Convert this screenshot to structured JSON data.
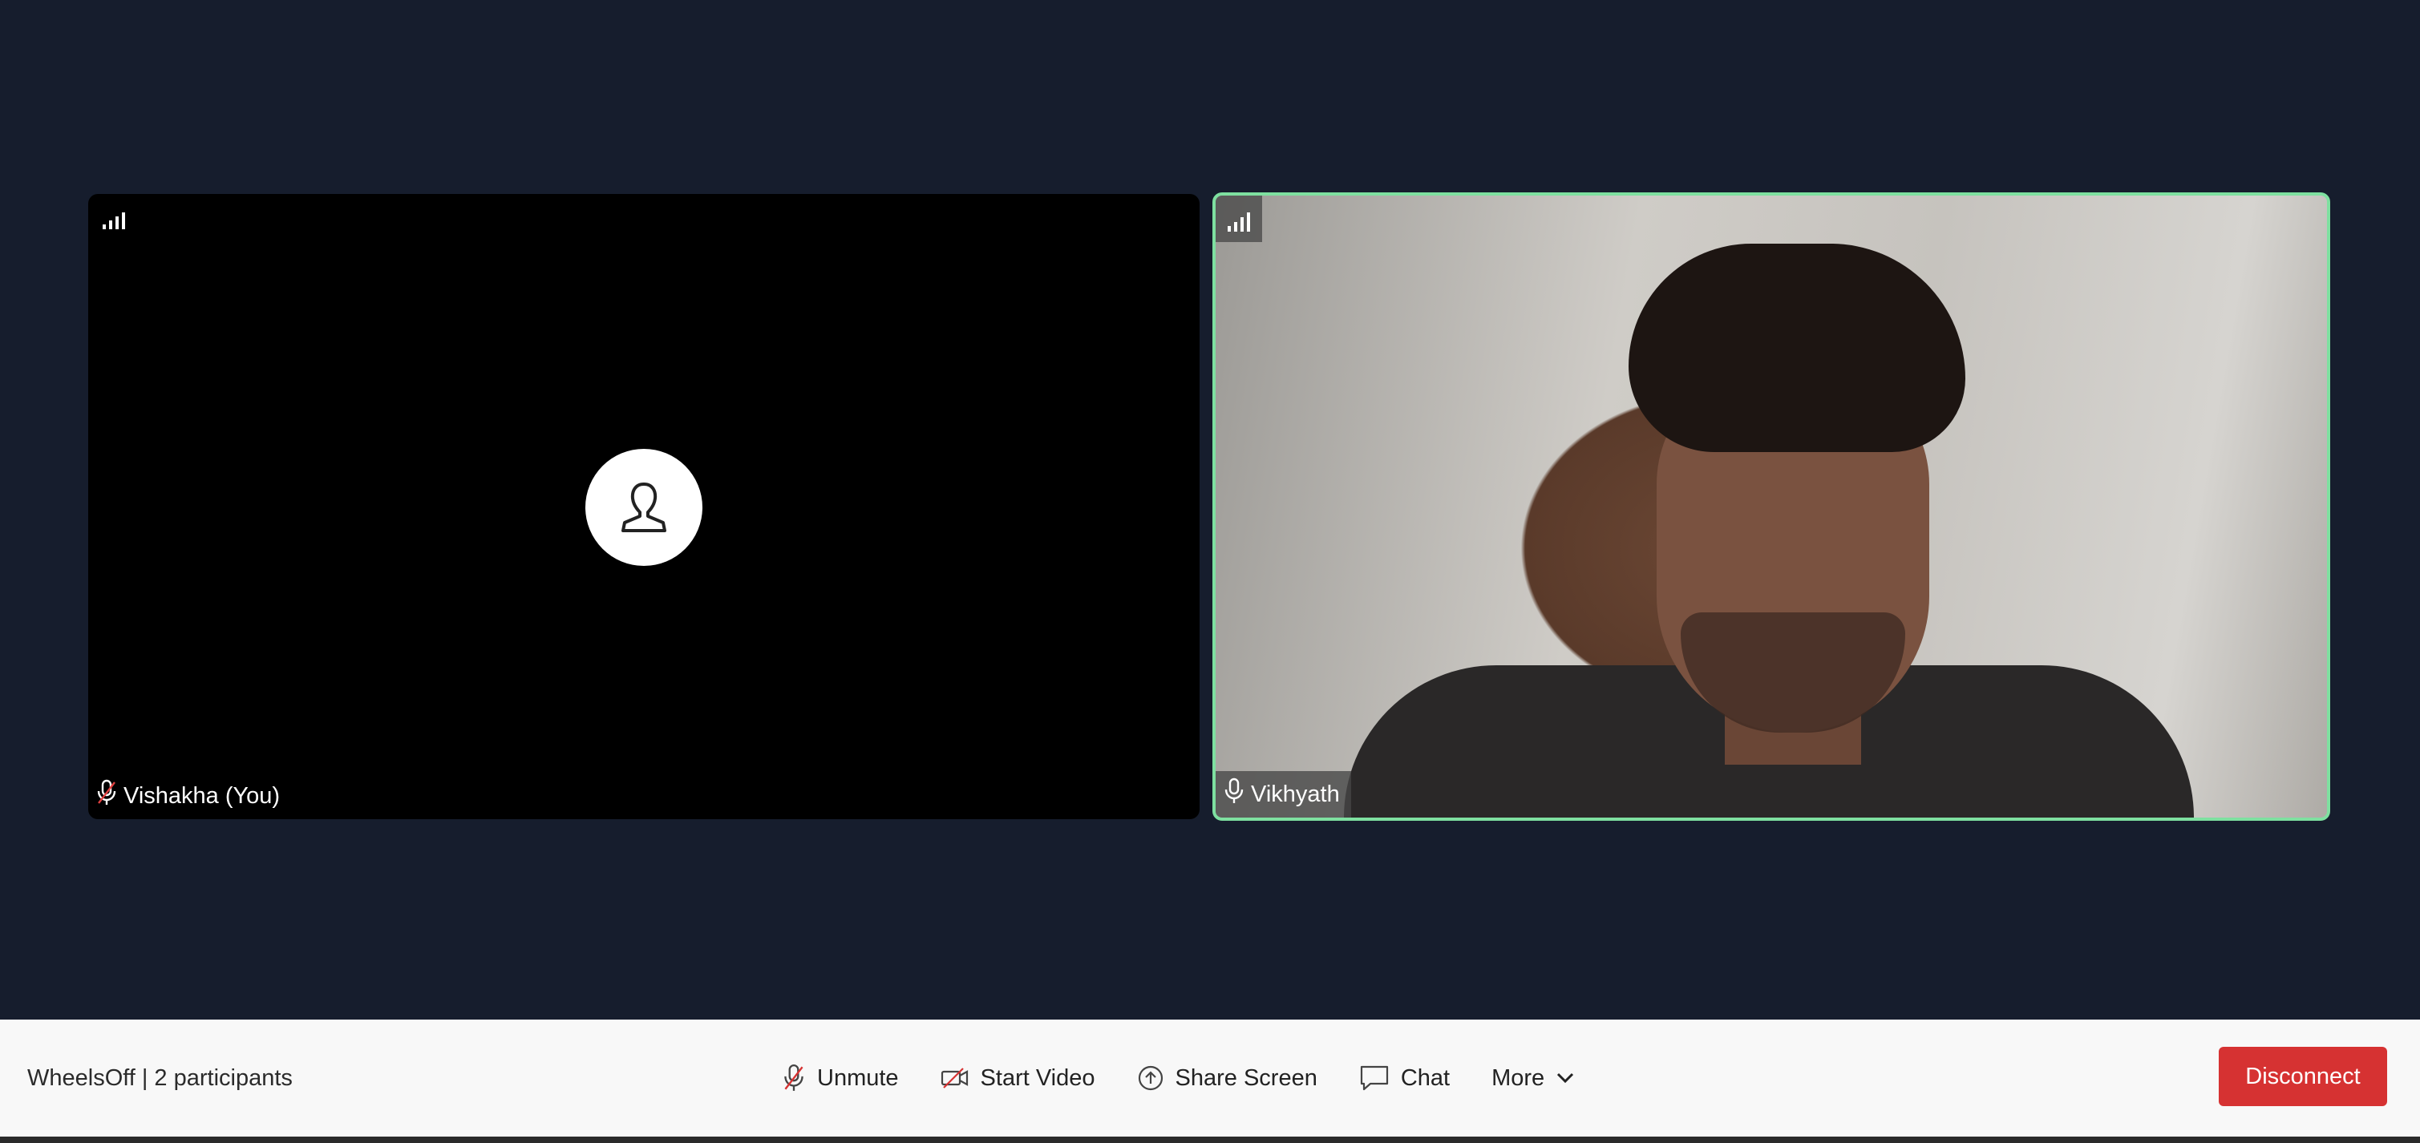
{
  "participants": {
    "self": {
      "name": "Vishakha (You)",
      "mic_state": "muted",
      "video_state": "off",
      "signal_icon": "signal-bars-icon"
    },
    "remote": {
      "name": "Vikhyath",
      "mic_state": "unmuted",
      "video_state": "on",
      "active_speaker": true,
      "highlight_color": "#7ee0a0",
      "signal_icon": "signal-bars-icon"
    }
  },
  "toolbar": {
    "meeting_name": "WheelsOff",
    "separator": "|",
    "participant_count": "2 participants",
    "unmute_label": "Unmute",
    "start_video_label": "Start Video",
    "share_screen_label": "Share Screen",
    "chat_label": "Chat",
    "more_label": "More",
    "disconnect_label": "Disconnect"
  },
  "colors": {
    "background": "#161d2d",
    "toolbar_bg": "#f8f8f8",
    "disconnect_bg": "#d63232",
    "muted_icon": "#d63232"
  }
}
